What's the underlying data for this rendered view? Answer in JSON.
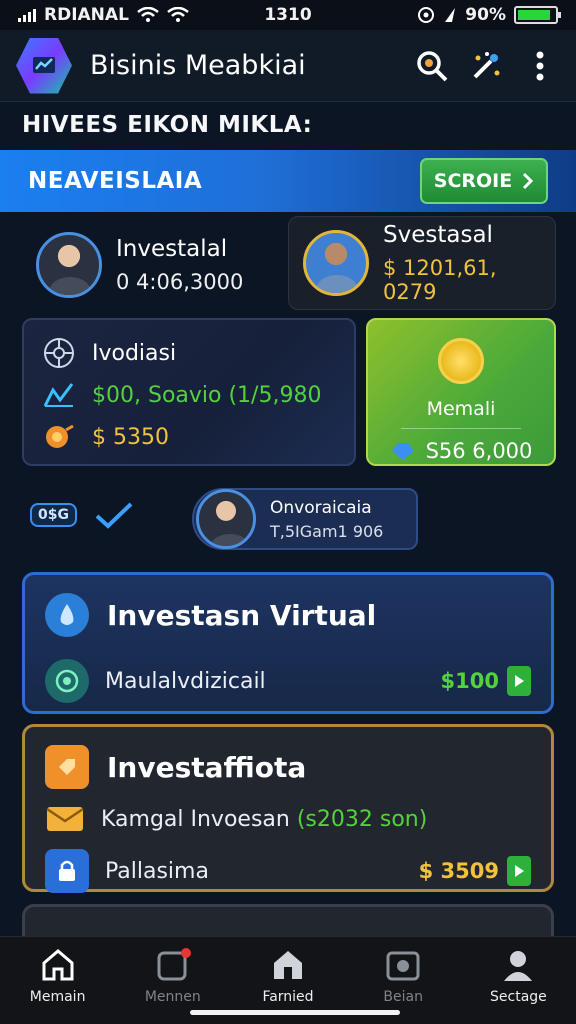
{
  "status_bar": {
    "carrier": "RDIANAL",
    "time": "1310",
    "battery": "90%",
    "battery_level": 0.9
  },
  "app_bar": {
    "title": "Bisinis Meabkiai",
    "icons": [
      "search-icon",
      "magic-wand-icon",
      "more-vert-icon"
    ]
  },
  "section_title": "HIVEES EIKON MIKLA:",
  "banner": {
    "text": "NEAVEISLAIA",
    "button_label": "SCROIE"
  },
  "persons": [
    {
      "name": "Investalal",
      "amount": "0 4:06,3000"
    },
    {
      "name": "Svestasal",
      "amount": "$ 1201,61, 0279"
    }
  ],
  "invest_card": {
    "title": "Ivodiasi",
    "line1": "$00, Soavio (1/5,980",
    "line2": "$ 5350"
  },
  "green_card": {
    "label": "Memali",
    "value": "S56 6,000"
  },
  "mini_row": {
    "badge": "0$G",
    "mini_title": "Onvoraicaia",
    "mini_sub": "T,5IGam1 906"
  },
  "card_virtual": {
    "title": "Investasn Virtual",
    "row_text": "Maulalvdizicail",
    "price": "$100"
  },
  "card_afflota": {
    "title": "Investaffiota",
    "row1_text": "Kamgal Invoesan",
    "row1_highlight": "(s2032 son)",
    "row2_text": "Pallasima",
    "row2_price": "$ 3509"
  },
  "bottom_nav": [
    {
      "label": "Memain",
      "icon": "home-icon"
    },
    {
      "label": "Mennen",
      "icon": "notification-icon"
    },
    {
      "label": "Farnied",
      "icon": "house-icon"
    },
    {
      "label": "Beian",
      "icon": "camera-icon"
    },
    {
      "label": "Sectage",
      "icon": "profile-icon"
    }
  ],
  "colors": {
    "accent_blue": "#1a7ff0",
    "accent_green": "#2db13a",
    "gold": "#e3b53a",
    "background": "#0b1524"
  }
}
